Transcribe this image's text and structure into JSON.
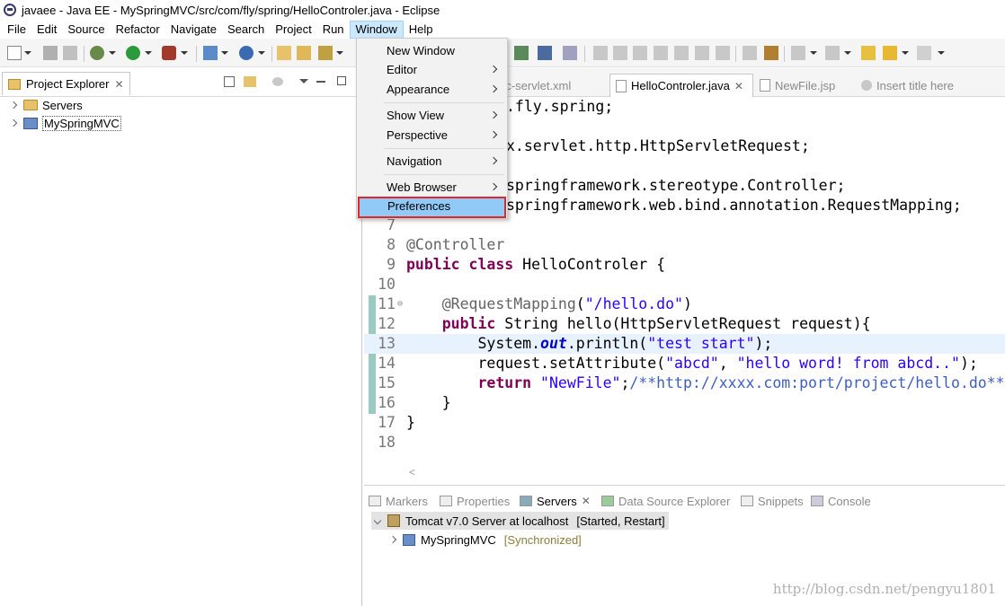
{
  "window": {
    "title": "javaee - Java EE - MySpringMVC/src/com/fly/spring/HelloControler.java - Eclipse"
  },
  "menubar": [
    "File",
    "Edit",
    "Source",
    "Refactor",
    "Navigate",
    "Search",
    "Project",
    "Run",
    "Window",
    "Help"
  ],
  "window_menu": {
    "items": [
      "New Window",
      "Editor",
      "Appearance",
      "Show View",
      "Perspective",
      "Navigation",
      "Web Browser",
      "Preferences"
    ],
    "highlighted": "Preferences"
  },
  "project_explorer": {
    "tab_label": "Project Explorer",
    "items": [
      "Servers",
      "MySpringMVC"
    ]
  },
  "editor": {
    "tabs": [
      "mvc-servlet.xml",
      "HelloControler.java",
      "NewFile.jsp",
      "Insert title here"
    ],
    "active_tab": "HelloControler.java",
    "lines": [
      {
        "n": "",
        "text": ".fly.spring;"
      },
      {
        "n": "",
        "text": ""
      },
      {
        "n": "",
        "text": "x.servlet.http.HttpServletRequest;"
      },
      {
        "n": "",
        "text": ""
      },
      {
        "n": "",
        "text": "springframework.stereotype.Controller;"
      },
      {
        "n": "",
        "text": "springframework.web.bind.annotation.RequestMapping;"
      },
      {
        "n": "7",
        "text": ""
      },
      {
        "n": "8",
        "text": "@Controller"
      },
      {
        "n": "9",
        "text": "public class HelloControler {"
      },
      {
        "n": "10",
        "text": ""
      },
      {
        "n": "11",
        "text": "    @RequestMapping(\"/hello.do\")"
      },
      {
        "n": "12",
        "text": "    public String hello(HttpServletRequest request){"
      },
      {
        "n": "13",
        "text": "        System.out.println(\"test start\");"
      },
      {
        "n": "14",
        "text": "        request.setAttribute(\"abcd\", \"hello word! from abcd..\");"
      },
      {
        "n": "15",
        "text": "        return \"NewFile\";/**http://xxxx.com:port/project/hello.do**"
      },
      {
        "n": "16",
        "text": "    }"
      },
      {
        "n": "17",
        "text": "}"
      },
      {
        "n": "18",
        "text": ""
      }
    ]
  },
  "bottom_panel": {
    "tabs": [
      "Markers",
      "Properties",
      "Servers",
      "Data Source Explorer",
      "Snippets",
      "Console"
    ],
    "active_tab": "Servers",
    "server": {
      "name": "Tomcat v7.0 Server at localhost",
      "status": "[Started, Restart]"
    },
    "module": {
      "name": "MySpringMVC",
      "status": "[Synchronized]"
    }
  },
  "watermark": "http://blog.csdn.net/pengyu1801",
  "colors": {
    "keyword": "#7f0055",
    "string": "#2a00ff",
    "annotation": "#646464",
    "menu_highlight": "#91c9f7",
    "highlight_border": "#e0282c"
  }
}
